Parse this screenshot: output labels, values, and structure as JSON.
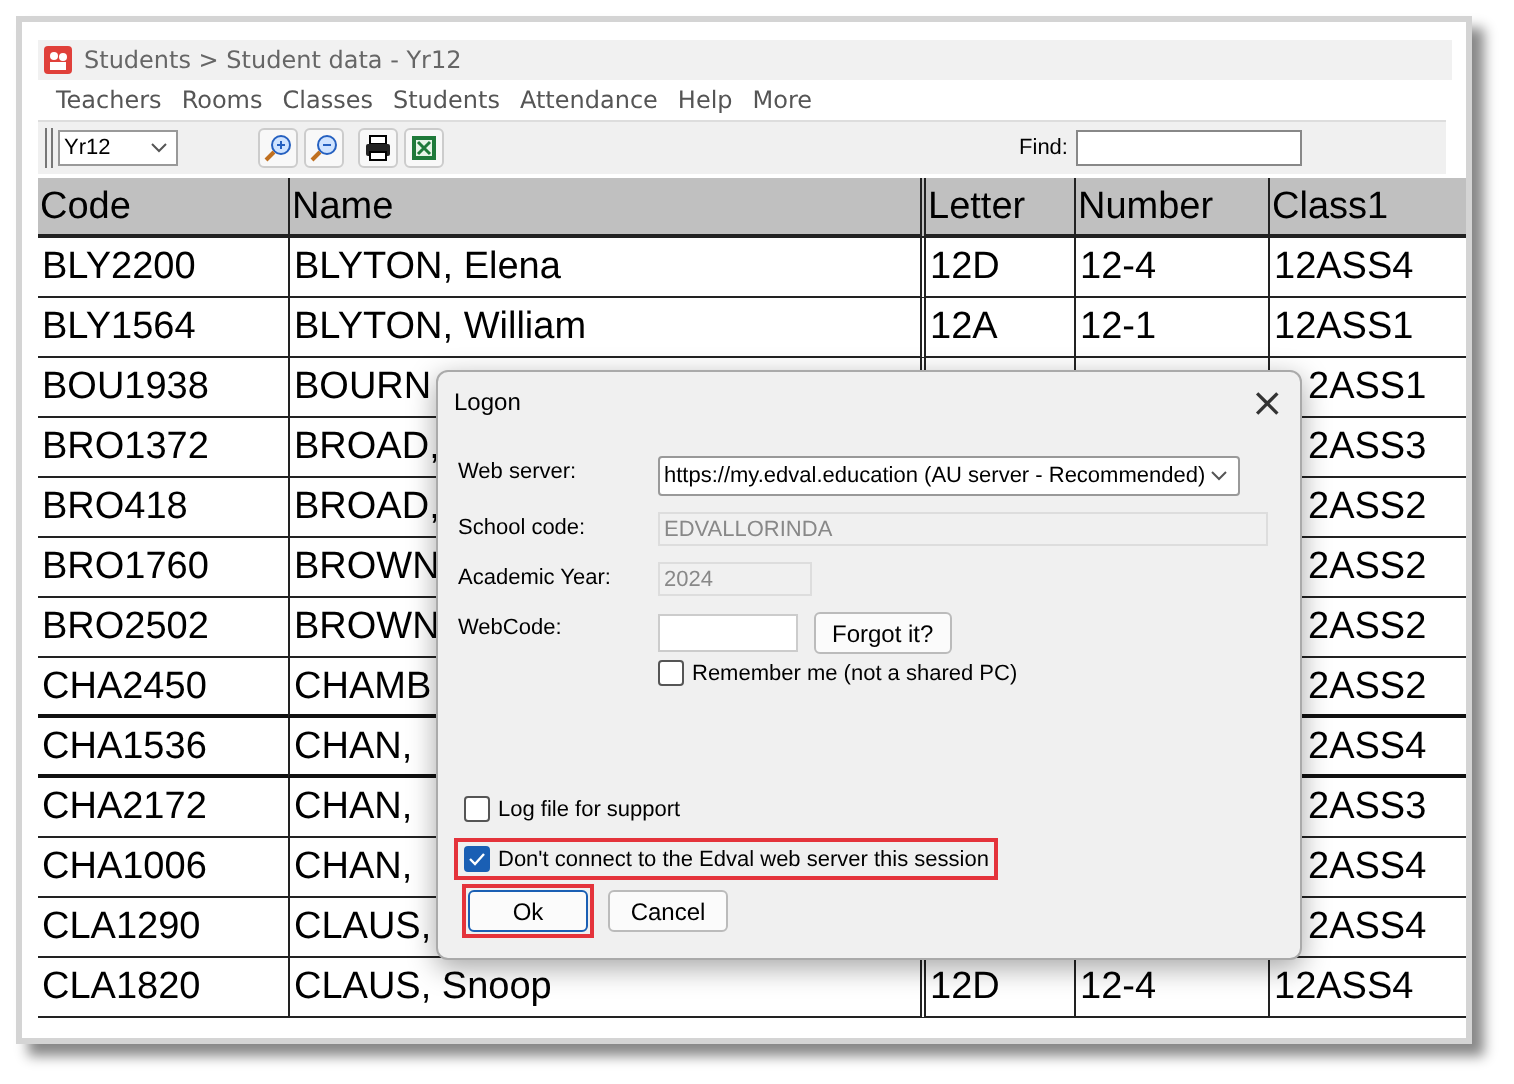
{
  "window": {
    "title": "Students > Student data - Yr12"
  },
  "menu": [
    "Teachers",
    "Rooms",
    "Classes",
    "Students",
    "Attendance",
    "Help",
    "More"
  ],
  "toolbar": {
    "year_select": "Yr12",
    "find_label": "Find:"
  },
  "table": {
    "columns": [
      "Code",
      "Name",
      "Letter",
      "Number",
      "Class1"
    ],
    "rows": [
      {
        "code": "BLY2200",
        "name": "BLYTON, Elena",
        "letter": "12D",
        "number": "12-4",
        "class1": "12ASS4"
      },
      {
        "code": "BLY1564",
        "name": "BLYTON, William",
        "letter": "12A",
        "number": "12-1",
        "class1": "12ASS1"
      },
      {
        "code": "BOU1938",
        "name": "BOURN",
        "class1": "2ASS1"
      },
      {
        "code": "BRO1372",
        "name": "BROAD,",
        "class1": "2ASS3"
      },
      {
        "code": "BRO418",
        "name": "BROAD,",
        "class1": "2ASS2"
      },
      {
        "code": "BRO1760",
        "name": "BROWN",
        "class1": "2ASS2"
      },
      {
        "code": "BRO2502",
        "name": "BROWN",
        "class1": "2ASS2"
      },
      {
        "code": "CHA2450",
        "name": "CHAMB",
        "class1": "2ASS2"
      },
      {
        "code": "CHA1536",
        "name": "CHAN,",
        "class1": "2ASS4"
      },
      {
        "code": "CHA2172",
        "name": "CHAN,",
        "class1": "2ASS3"
      },
      {
        "code": "CHA1006",
        "name": "CHAN,",
        "class1": "2ASS4"
      },
      {
        "code": "CLA1290",
        "name": "CLAUS,",
        "class1": "2ASS4"
      },
      {
        "code": "CLA1820",
        "name": "CLAUS, Snoop",
        "letter": "12D",
        "number": "12-4",
        "class1": "12ASS4"
      }
    ]
  },
  "dialog": {
    "title": "Logon",
    "close": "×",
    "fields": [
      {
        "kind": "select",
        "label": "Web server:",
        "value": "https://my.edval.education (AU server - Recommended)"
      },
      {
        "kind": "readonly",
        "label": "School code:",
        "value": "EDVALLORINDA"
      },
      {
        "kind": "readonly_short",
        "label": "Academic Year:",
        "value": "2024"
      },
      {
        "kind": "code",
        "label": "WebCode:",
        "button": "Forgot it?"
      }
    ],
    "remember": {
      "label": "Remember me (not a shared PC)",
      "checked": false
    },
    "options": [
      {
        "label": "Log file for support",
        "checked": false,
        "highlighted": false
      },
      {
        "label": "Don't connect to the Edval web server this session",
        "checked": true,
        "highlighted": true
      }
    ],
    "buttons": [
      {
        "label": "Ok",
        "highlighted": true
      },
      {
        "label": "Cancel",
        "highlighted": false
      }
    ]
  }
}
